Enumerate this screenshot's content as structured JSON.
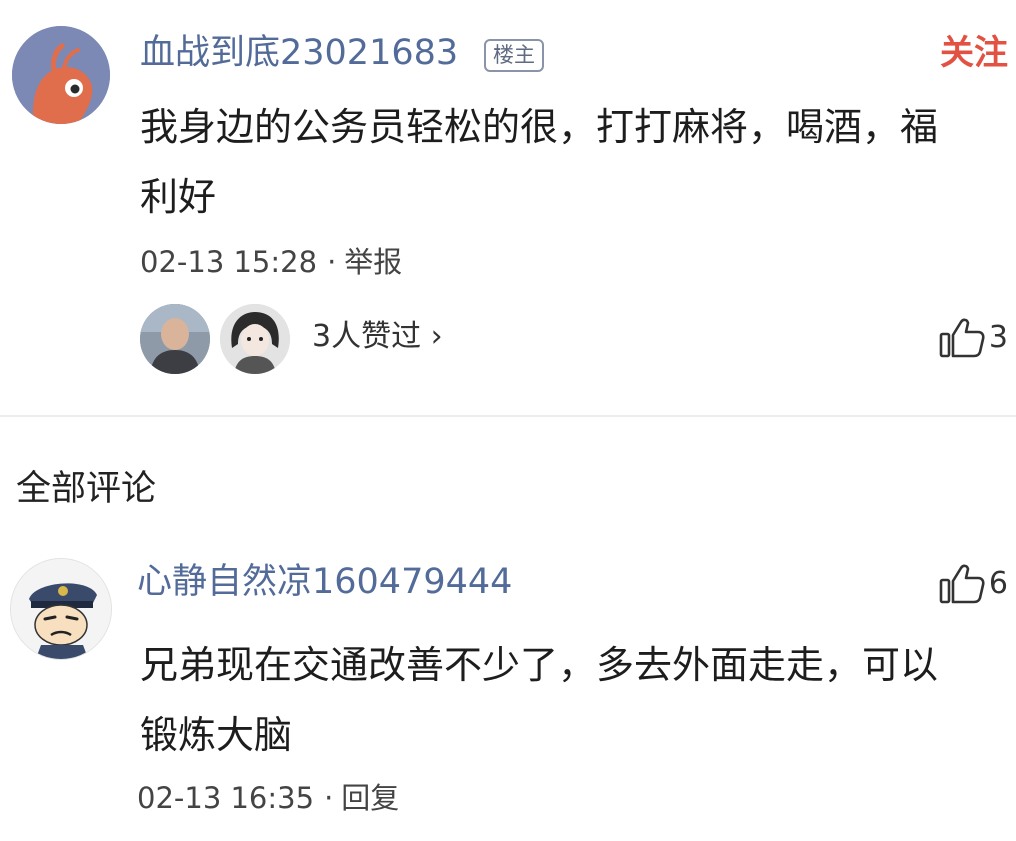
{
  "post": {
    "username": "血战到底23021683",
    "badge": "楼主",
    "follow_label": "关注",
    "text": "我身边的公务员轻松的很，打打麻将，喝酒，福利好",
    "time": "02-13 15:28",
    "separator": "·",
    "report_label": "举报",
    "likers_text": "3人赞过",
    "likers_chevron": "›",
    "like_count": "3"
  },
  "section_title": "全部评论",
  "comments": [
    {
      "username": "心静自然凉160479444",
      "text": "兄弟现在交通改善不少了，多去外面走走，可以锻炼大脑",
      "time": "02-13 16:35",
      "separator": "·",
      "reply_label": "回复",
      "like_count": "6"
    }
  ],
  "icons": {
    "like": "thumbs-up-icon",
    "op_avatar": "shrimp-avatar",
    "commenter_avatar": "police-cartoon-avatar"
  },
  "colors": {
    "username": "#536b99",
    "follow": "#e25142",
    "divider": "#ececec"
  }
}
